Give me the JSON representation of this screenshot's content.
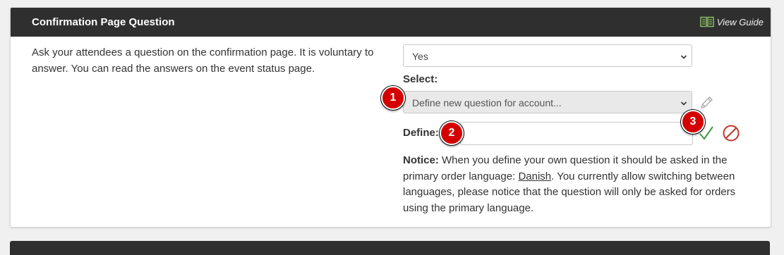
{
  "panel": {
    "title": "Confirmation Page Question",
    "guide_label": "View Guide",
    "description": "Ask your attendees a question on the confirmation page. It is voluntary to answer. You can read the answers on the event status page."
  },
  "form": {
    "enabled_select": {
      "value": "Yes"
    },
    "select_label": "Select:",
    "question_select": {
      "value": "Define new question for account..."
    },
    "define_label": "Define:",
    "define_input": {
      "value": "",
      "placeholder": ""
    }
  },
  "notice": {
    "label": "Notice:",
    "text_before": "When you define your own question it should be asked in the primary order language:",
    "language": "Danish",
    "text_after": ". You currently allow switching between languages, please notice that the question will only be asked for orders using the primary language."
  },
  "markers": [
    "1",
    "2",
    "3"
  ],
  "icons": {
    "guide": "book-icon",
    "edit": "pencil-icon",
    "confirm": "checkmark-icon",
    "cancel": "cancel-icon",
    "dropdown": "chevron-down-icon"
  },
  "colors": {
    "header_bg": "#2f2f2f",
    "confirm": "#3c9a3c",
    "cancel": "#c0392b",
    "marker": "#d40000"
  }
}
